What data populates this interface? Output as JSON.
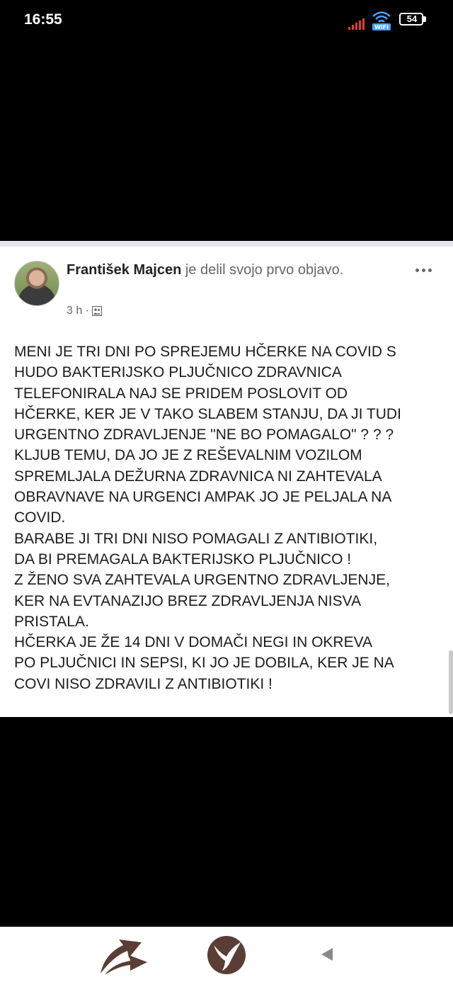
{
  "status_bar": {
    "time": "16:55",
    "battery_level": "54",
    "signal_icon": "signal-bars-icon",
    "wifi_icon": "wifi-icon"
  },
  "post": {
    "author": "František Majcen",
    "action_text": " je delil svojo prvo objavo.",
    "time_ago": "3 h",
    "separator": "·",
    "audience_icon": "friends-icon",
    "more_icon": "more-dots-icon",
    "body_lines": [
      "MENI JE TRI DNI PO SPREJEMU HČERKE NA COVID  S",
      "HUDO BAKTERIJSKO PLJUČNICO ZDRAVNICA",
      "TELEFONIRALA NAJ SE PRIDEM POSLOVIT OD",
      "HČERKE, KER JE V TAKO SLABEM STANJU, DA JI TUDI",
      "URGENTNO ZDRAVLJENJE \"NE BO POMAGALO\" ? ? ?",
      "KLJUB TEMU, DA JO JE Z REŠEVALNIM VOZILOM",
      "SPREMLJALA DEŽURNA ZDRAVNICA NI ZAHTEVALA",
      "OBRAVNAVE NA URGENCI AMPAK JO JE PELJALA NA",
      "COVID.",
      "BARABE JI TRI DNI NISO POMAGALI Z ANTIBIOTIKI,",
      "DA BI PREMAGALA BAKTERIJSKO PLJUČNICO !",
      "Z ŽENO SVA ZAHTEVALA URGENTNO ZDRAVLJENJE,",
      "KER NA EVTANAZIJO BREZ ZDRAVLJENJA  NISVA",
      "PRISTALA.",
      "HČERKA JE ŽE 14 DNI V DOMAČI NEGI IN OKREVA",
      "PO PLJUČNICI IN SEPSI, KI JO JE DOBILA, KER JE NA",
      "COVI NISO ZDRAVILI Z ANTIBIOTIKI !"
    ]
  },
  "nav_bar": {
    "left_icon": "bird-arrows-logo-icon",
    "center_icon": "bird-circle-logo-icon",
    "back_icon": "back-triangle-icon"
  },
  "colors": {
    "background": "#000000",
    "card": "#ffffff",
    "logo_brown": "#5a3e36"
  }
}
